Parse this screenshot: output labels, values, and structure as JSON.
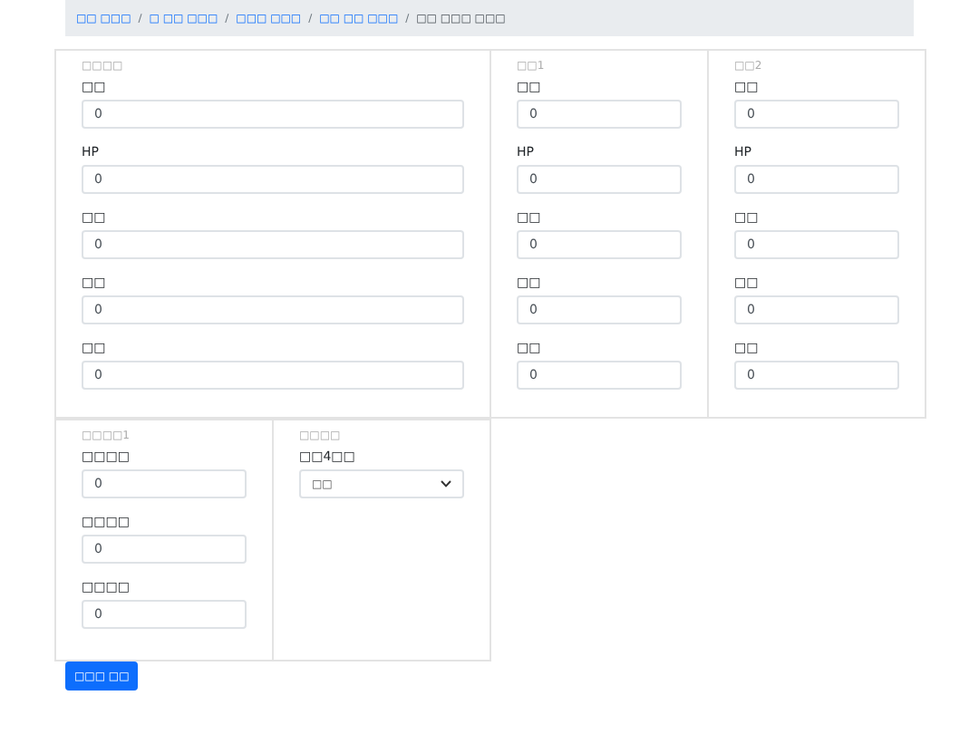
{
  "breadcrumb": [
    {
      "label": "□□ □□□",
      "current": false
    },
    {
      "separator": "/",
      "label": "□ □□ □□□",
      "current": false
    },
    {
      "separator": "/",
      "label": "□□□ □□□",
      "current": false
    },
    {
      "separator": "/",
      "label": "□□ □□ □□□",
      "current": false
    },
    {
      "separator": "/",
      "label": "□□ □□□ □□□",
      "current": true
    }
  ],
  "card_rows": [
    [
      {
        "title": "□□□□",
        "fields": [
          {
            "kind": "input",
            "label": "□□",
            "value": "0"
          },
          {
            "kind": "input",
            "label": "HP",
            "value": "0"
          },
          {
            "kind": "input",
            "label": "□□",
            "value": "0"
          },
          {
            "kind": "input",
            "label": "□□",
            "value": "0"
          },
          {
            "kind": "input",
            "label": "□□",
            "value": "0"
          }
        ]
      },
      {
        "title": "□□1",
        "fields": [
          {
            "kind": "input",
            "label": "□□",
            "value": "0"
          },
          {
            "kind": "input",
            "label": "HP",
            "value": "0"
          },
          {
            "kind": "input",
            "label": "□□",
            "value": "0"
          },
          {
            "kind": "input",
            "label": "□□",
            "value": "0"
          },
          {
            "kind": "input",
            "label": "□□",
            "value": "0"
          }
        ]
      },
      {
        "title": "□□2",
        "fields": [
          {
            "kind": "input",
            "label": "□□",
            "value": "0"
          },
          {
            "kind": "input",
            "label": "HP",
            "value": "0"
          },
          {
            "kind": "input",
            "label": "□□",
            "value": "0"
          },
          {
            "kind": "input",
            "label": "□□",
            "value": "0"
          },
          {
            "kind": "input",
            "label": "□□",
            "value": "0"
          }
        ]
      }
    ],
    [
      {
        "title": "□□□□1",
        "fields": [
          {
            "kind": "input",
            "label": "□□□□",
            "value": "0"
          },
          {
            "kind": "input",
            "label": "□□□□",
            "value": "0"
          },
          {
            "kind": "input",
            "label": "□□□□",
            "value": "0"
          }
        ]
      },
      {
        "title": "□□□□",
        "fields": [
          {
            "kind": "select",
            "label": "□□4□□",
            "value": "□□"
          }
        ]
      }
    ]
  ],
  "submit_button": "□□□ □□"
}
